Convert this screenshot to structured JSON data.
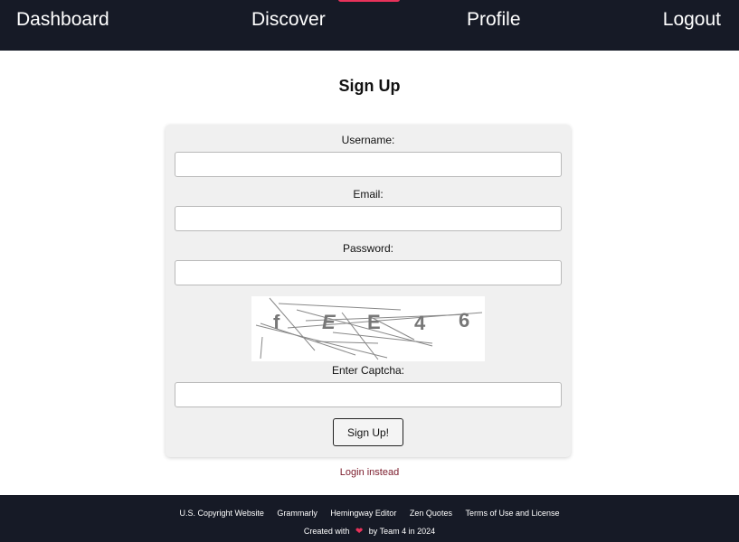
{
  "nav": {
    "items": [
      {
        "label": "Dashboard"
      },
      {
        "label": "Discover"
      },
      {
        "label": "Profile"
      },
      {
        "label": "Logout"
      }
    ],
    "accent_color": "#e8325a"
  },
  "page": {
    "title": "Sign Up"
  },
  "form": {
    "username_label": "Username:",
    "username_value": "",
    "email_label": "Email:",
    "email_value": "",
    "password_label": "Password:",
    "password_value": "",
    "captcha_text": [
      "f",
      "E",
      "E",
      "4",
      "6"
    ],
    "captcha_label": "Enter Captcha:",
    "captcha_value": "",
    "submit_label": "Sign Up!"
  },
  "login_link": "Login instead",
  "footer": {
    "links": [
      {
        "label": "U.S. Copyright Website"
      },
      {
        "label": "Grammarly"
      },
      {
        "label": "Hemingway Editor"
      },
      {
        "label": "Zen Quotes"
      },
      {
        "label": "Terms of Use and License"
      }
    ],
    "credit_prefix": "Created with",
    "credit_icon": "heart-icon",
    "credit_suffix": "by Team 4 in 2024"
  },
  "colors": {
    "nav_bg": "#161a26",
    "card_bg": "#f0f0f0",
    "link_color": "#7a1a2a",
    "heart": "#e8325a"
  }
}
